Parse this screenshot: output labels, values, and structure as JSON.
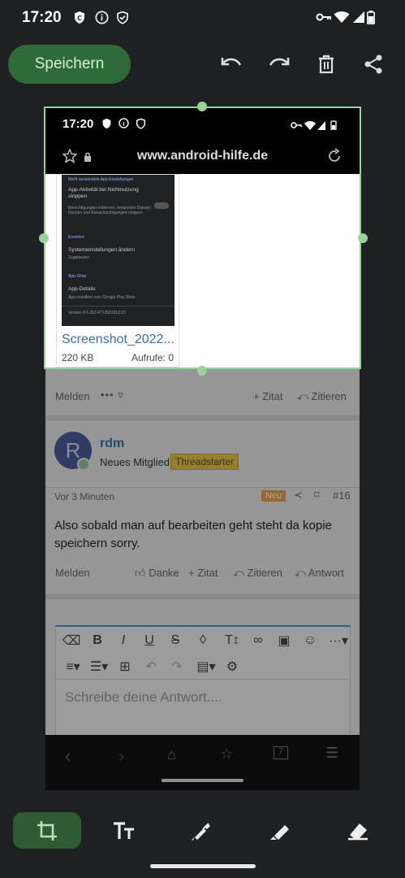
{
  "status_bar": {
    "time": "17:20"
  },
  "top_bar": {
    "save_label": "Speichern"
  },
  "preview": {
    "inner_time": "17:20",
    "url": "www.android-hilfe.de",
    "thumb": {
      "heading1": "Nicht verwendete App-Einstellungen",
      "item1_title": "App-Aktivität bei Nichtnutzung stoppen",
      "item1_sub": "Berechtigungen entfernen, temporäre Dateien löschen und Benachrichtigungen stoppen",
      "heading2": "Erweitert",
      "item2_title": "Systemeinstellungen ändern",
      "item2_sub": "Zugelassen",
      "heading3": "App-Shop",
      "item3_title": "App-Details",
      "item3_sub": "App installiert vom Google Play Store",
      "version": "Version 8.6.263.4713581013.15"
    },
    "filename": "Screenshot_2022...",
    "filesize": "220 KB",
    "views": "Aufrufe: 0",
    "post1_actions": {
      "report": "Melden",
      "more": "•••",
      "quote": "Zitat",
      "cite": "Zitieren"
    },
    "post2": {
      "avatar_letter": "R",
      "username": "rdm",
      "role": "Neues Mitglied",
      "badge": "Threadstarter",
      "time": "Vor 3 Minuten",
      "new_badge": "Neu",
      "number": "#16",
      "text": "Also sobald man auf bearbeiten geht steht da kopie speichern sorry.",
      "report": "Melden",
      "thanks": "Danke",
      "quote": "Zitat",
      "cite": "Zitieren",
      "reply": "Antwort"
    },
    "editor": {
      "placeholder": "Schreibe deine Antwort...."
    }
  },
  "colors": {
    "accent": "#9ad39a",
    "save_bg": "#2f6a3a",
    "link": "#3a6ea8",
    "badge": "#e6c44a"
  }
}
